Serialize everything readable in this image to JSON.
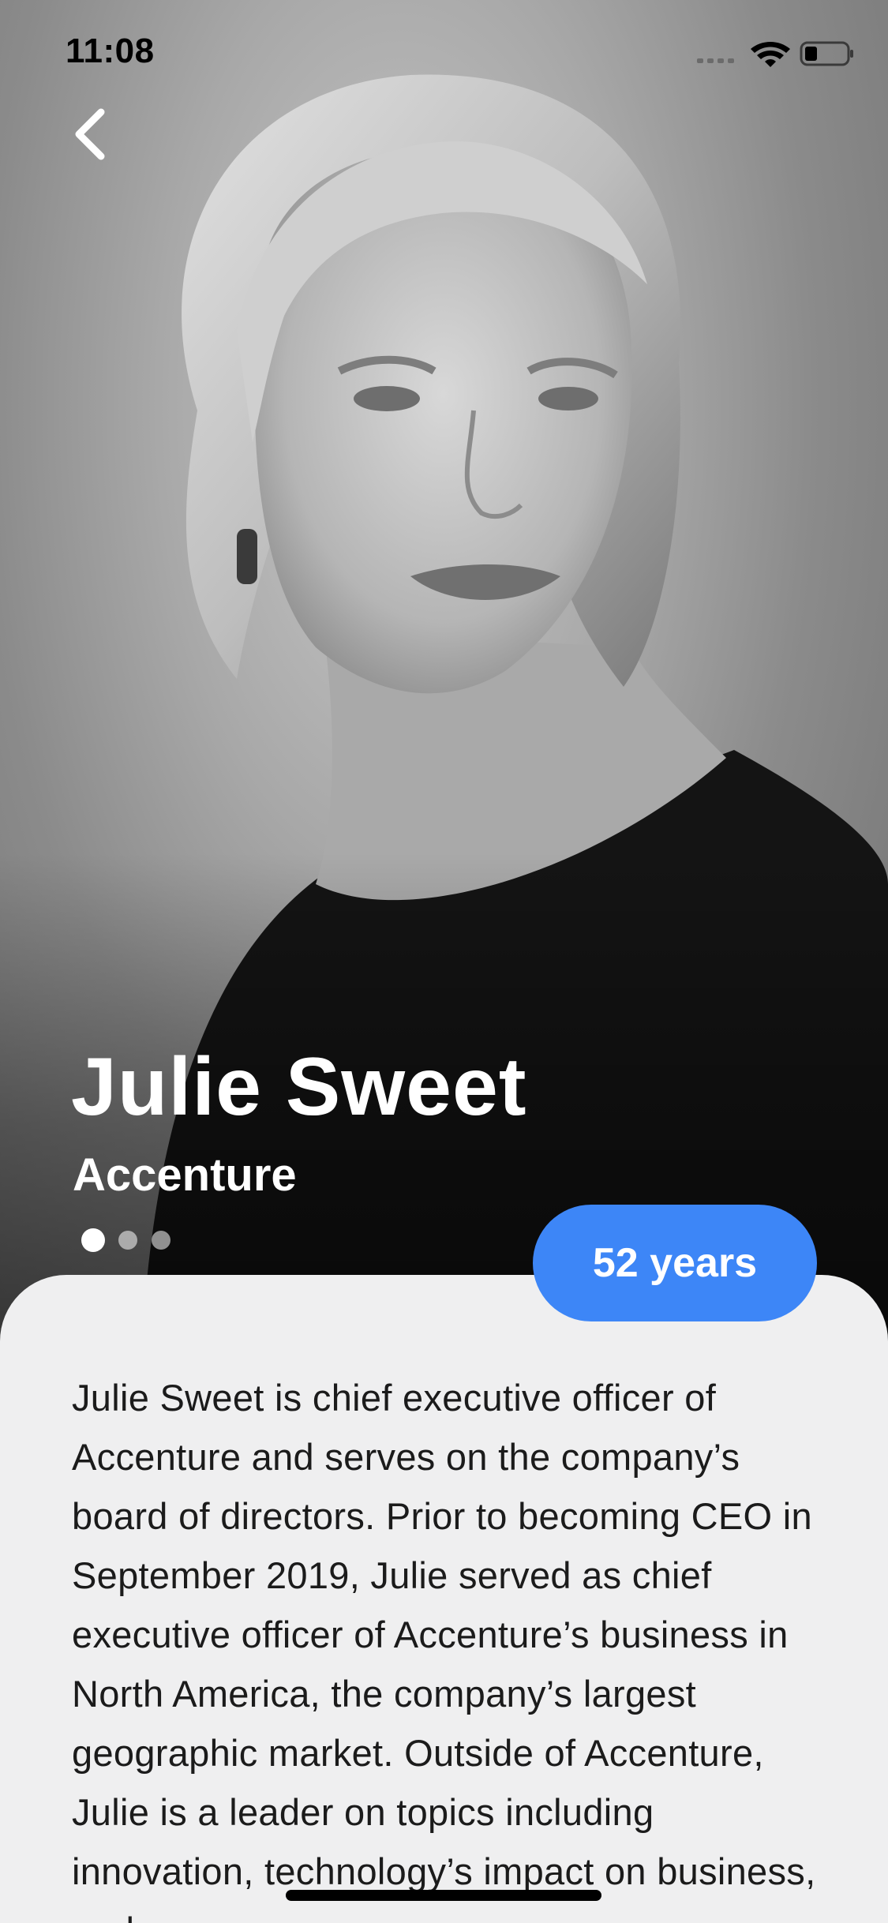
{
  "status_bar": {
    "time": "11:08"
  },
  "profile": {
    "name": "Julie Sweet",
    "company": "Accenture",
    "age_label": "52 years",
    "photo_pages": 3,
    "current_photo_index": 0,
    "bio": "Julie Sweet is chief executive officer of Accenture and serves on the company’s board of directors. Prior to becoming CEO in September 2019, Julie served as chief executive officer of Accenture’s business in North America, the company’s largest geographic market. Outside of Accenture, Julie is a leader on topics including innovation, technology’s impact on business, and"
  },
  "icons": {
    "back": "chevron-left-icon",
    "signal": "cellular-signal-icon",
    "wifi": "wifi-icon",
    "battery": "battery-icon"
  },
  "colors": {
    "accent": "#3d86f7",
    "card_background": "#efeff0",
    "text_primary": "#1b1b1b"
  }
}
